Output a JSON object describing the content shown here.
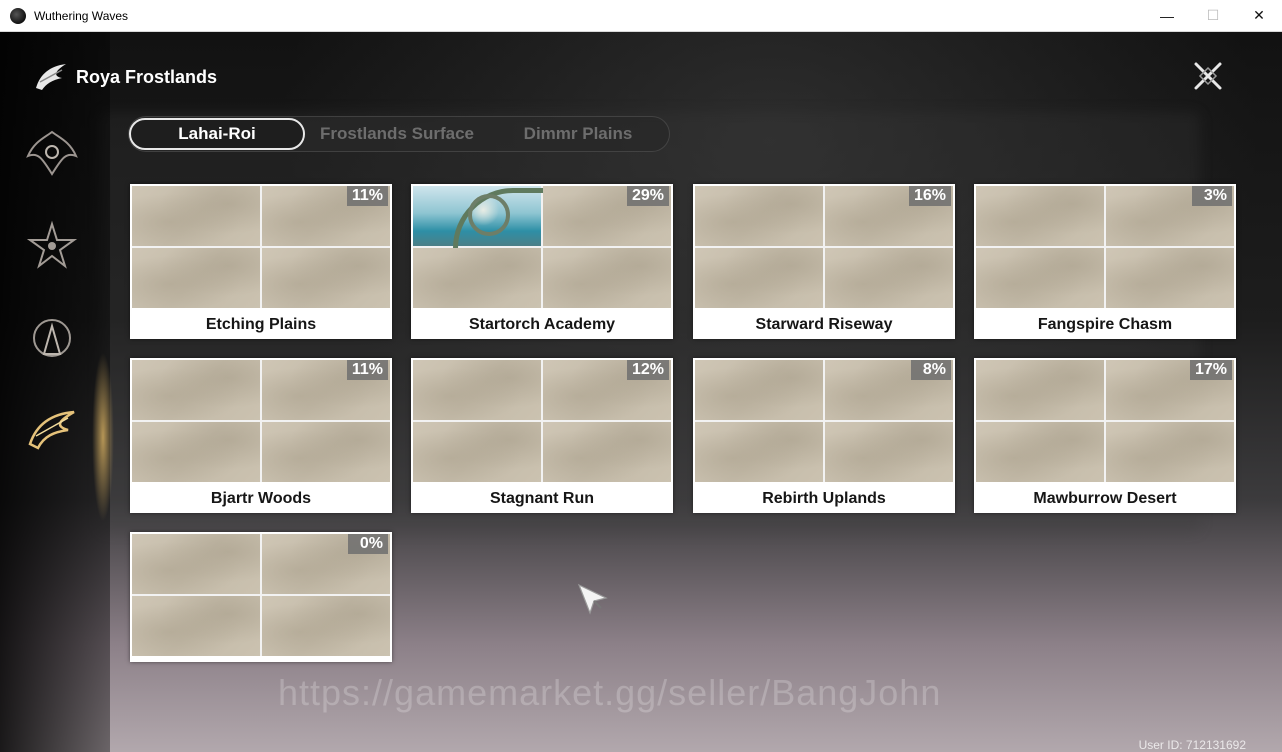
{
  "window": {
    "title": "Wuthering Waves",
    "controls": {
      "minimize": "—",
      "maximize": "☐",
      "close": "✕"
    }
  },
  "header": {
    "region_title": "Roya Frostlands"
  },
  "tabs": [
    {
      "label": "Lahai-Roi",
      "active": true
    },
    {
      "label": "Frostlands Surface",
      "active": false
    },
    {
      "label": "Dimmr Plains",
      "active": false
    }
  ],
  "areas": [
    {
      "name": "Etching Plains",
      "percent": "11%"
    },
    {
      "name": "Startorch Academy",
      "percent": "29%"
    },
    {
      "name": "Starward Riseway",
      "percent": "16%"
    },
    {
      "name": "Fangspire Chasm",
      "percent": "3%"
    },
    {
      "name": "Bjartr Woods",
      "percent": "11%"
    },
    {
      "name": "Stagnant Run",
      "percent": "12%"
    },
    {
      "name": "Rebirth Uplands",
      "percent": "8%"
    },
    {
      "name": "Mawburrow Desert",
      "percent": "17%"
    },
    {
      "name": "",
      "percent": "0%"
    }
  ],
  "watermark": "https://gamemarket.gg/seller/BangJohn",
  "footer": {
    "user_id": "User ID: 712131692"
  },
  "icons": {
    "region_icons": [
      "dragon-crest-icon",
      "star-crest-icon",
      "goddess-crest-icon",
      "frostlands-crest-icon"
    ]
  }
}
